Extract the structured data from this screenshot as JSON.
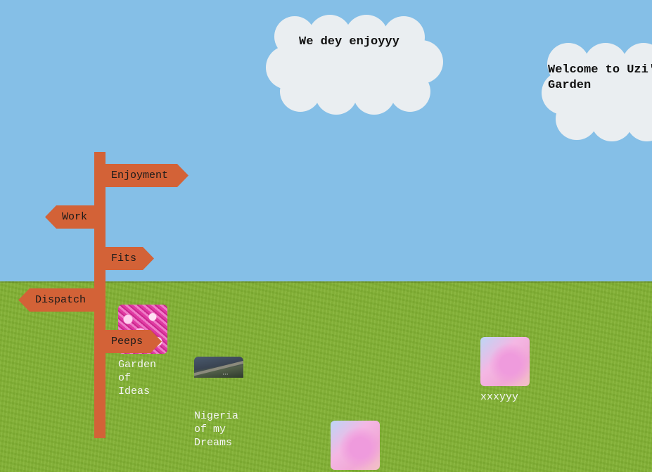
{
  "scene": {
    "colors": {
      "sky": "#85bfe7",
      "grass": "#82b233",
      "cloud": "#eaeef1",
      "signpost": "#d36237",
      "caption": "#f4f4f4"
    }
  },
  "clouds": [
    {
      "text": "We dey enjoyyy"
    },
    {
      "text": "Welcome to Uzi's Garden"
    }
  ],
  "signpost": {
    "signs": [
      {
        "label": "Enjoyment",
        "direction": "right"
      },
      {
        "label": "Work",
        "direction": "left"
      },
      {
        "label": "Fits",
        "direction": "right"
      },
      {
        "label": "Dispatch",
        "direction": "left"
      },
      {
        "label": "Peeps",
        "direction": "right"
      }
    ]
  },
  "garden_items": [
    {
      "caption": "Garden of Ideas",
      "icon": "pink-flower-thumbnail"
    },
    {
      "caption": "Nigeria of my Dreams",
      "icon": "mountain-photo-thumbnail"
    },
    {
      "caption": "xxxyyy",
      "icon": "pink-gradient-thumbnail"
    },
    {
      "caption": "",
      "icon": "pink-gradient-thumbnail"
    }
  ]
}
